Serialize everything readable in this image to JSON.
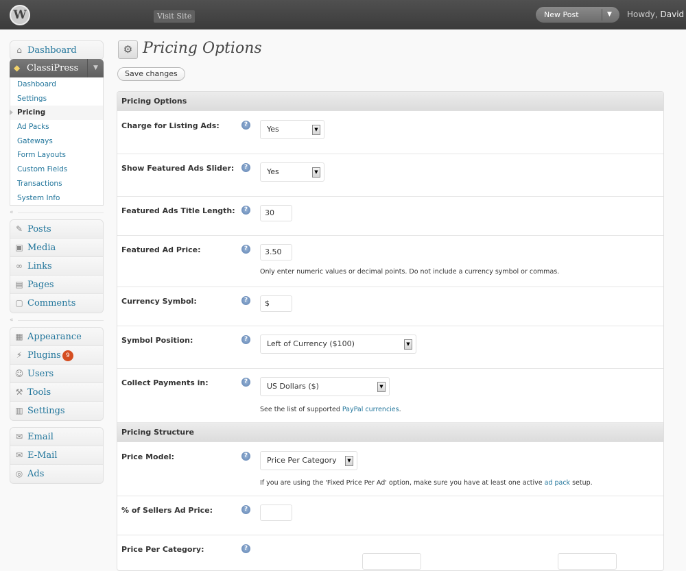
{
  "topbar": {
    "logo": "W",
    "visit_site": "Visit Site",
    "new_post": "New Post",
    "howdy_prefix": "Howdy, ",
    "user_name": "David"
  },
  "sidebar": {
    "dashboard": "Dashboard",
    "classipress": "ClassiPress",
    "classipress_sub": [
      "Dashboard",
      "Settings",
      "Pricing",
      "Ad Packs",
      "Gateways",
      "Form Layouts",
      "Custom Fields",
      "Transactions",
      "System Info"
    ],
    "content_items": [
      "Posts",
      "Media",
      "Links",
      "Pages",
      "Comments"
    ],
    "admin_items": [
      "Appearance",
      "Plugins",
      "Users",
      "Tools",
      "Settings"
    ],
    "plugins_badge": "9",
    "extra_items": [
      "Email",
      "E-Mail",
      "Ads"
    ]
  },
  "main": {
    "title": "Pricing Options",
    "save_label": "Save changes",
    "section1_title": "Pricing Options",
    "section2_title": "Pricing Structure",
    "help_glyph": "?",
    "fields": {
      "charge_listing": {
        "label": "Charge for Listing Ads:",
        "value": "Yes"
      },
      "featured_slider": {
        "label": "Show Featured Ads Slider:",
        "value": "Yes"
      },
      "title_length": {
        "label": "Featured Ads Title Length:",
        "value": "30"
      },
      "featured_price": {
        "label": "Featured Ad Price:",
        "value": "3.50",
        "desc": "Only enter numeric values or decimal points. Do not include a currency symbol or commas."
      },
      "currency_symbol": {
        "label": "Currency Symbol:",
        "value": "$"
      },
      "symbol_position": {
        "label": "Symbol Position:",
        "value": "Left of Currency ($100)"
      },
      "collect_payments": {
        "label": "Collect Payments in:",
        "value": "US Dollars ($)",
        "desc_prefix": "See the list of supported ",
        "desc_link": "PayPal currencies",
        "desc_suffix": "."
      },
      "price_model": {
        "label": "Price Model:",
        "value": "Price Per Category",
        "desc_prefix": "If you are using the 'Fixed Price Per Ad' option, make sure you have at least one active ",
        "desc_link": "ad pack",
        "desc_suffix": " setup."
      },
      "sellers_pct": {
        "label": "% of Sellers Ad Price:",
        "value": ""
      },
      "price_per_category": {
        "label": "Price Per Category:"
      }
    }
  }
}
